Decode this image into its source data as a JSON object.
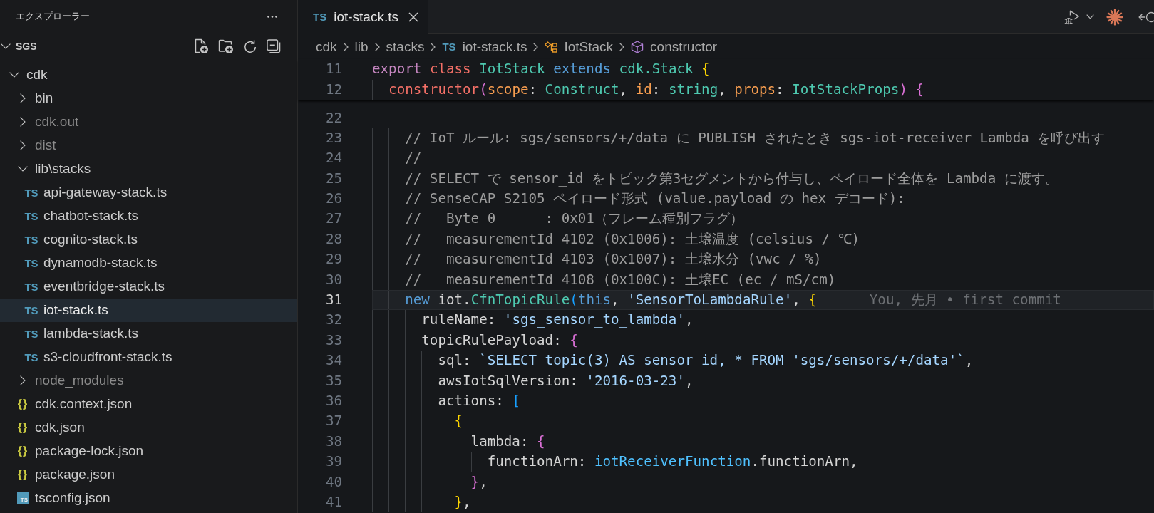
{
  "sidebar": {
    "title": "エクスプローラー",
    "workspace": {
      "name": "SGS",
      "expanded": true
    },
    "tree": [
      {
        "name": "cdk",
        "kind": "folder",
        "expanded": true,
        "selected": false,
        "dimmed": false,
        "children": [
          {
            "name": "bin",
            "kind": "folder",
            "expanded": false,
            "selected": false,
            "dimmed": false
          },
          {
            "name": "cdk.out",
            "kind": "folder",
            "expanded": false,
            "selected": false,
            "dimmed": true
          },
          {
            "name": "dist",
            "kind": "folder",
            "expanded": false,
            "selected": false,
            "dimmed": true
          },
          {
            "name": "lib\\stacks",
            "kind": "folder",
            "expanded": true,
            "selected": false,
            "dimmed": false,
            "children": [
              {
                "name": "api-gateway-stack.ts",
                "kind": "ts",
                "icon": "TS",
                "selected": false,
                "dimmed": false
              },
              {
                "name": "chatbot-stack.ts",
                "kind": "ts",
                "icon": "TS",
                "selected": false,
                "dimmed": false
              },
              {
                "name": "cognito-stack.ts",
                "kind": "ts",
                "icon": "TS",
                "selected": false,
                "dimmed": false
              },
              {
                "name": "dynamodb-stack.ts",
                "kind": "ts",
                "icon": "TS",
                "selected": false,
                "dimmed": false
              },
              {
                "name": "eventbridge-stack.ts",
                "kind": "ts",
                "icon": "TS",
                "selected": false,
                "dimmed": false
              },
              {
                "name": "iot-stack.ts",
                "kind": "ts",
                "icon": "TS",
                "selected": true,
                "dimmed": false
              },
              {
                "name": "lambda-stack.ts",
                "kind": "ts",
                "icon": "TS",
                "selected": false,
                "dimmed": false
              },
              {
                "name": "s3-cloudfront-stack.ts",
                "kind": "ts",
                "icon": "TS",
                "selected": false,
                "dimmed": false
              }
            ]
          },
          {
            "name": "node_modules",
            "kind": "folder",
            "expanded": false,
            "selected": false,
            "dimmed": true
          },
          {
            "name": "cdk.context.json",
            "kind": "json",
            "icon": "{}",
            "selected": false,
            "dimmed": false
          },
          {
            "name": "cdk.json",
            "kind": "json",
            "icon": "{}",
            "selected": false,
            "dimmed": false
          },
          {
            "name": "package-lock.json",
            "kind": "json",
            "icon": "{}",
            "selected": false,
            "dimmed": false
          },
          {
            "name": "package.json",
            "kind": "json",
            "icon": "{}",
            "selected": false,
            "dimmed": false
          },
          {
            "name": "tsconfig.json",
            "kind": "tsconfig",
            "icon": "TS",
            "selected": false,
            "dimmed": false
          }
        ]
      }
    ]
  },
  "editor": {
    "tabs": [
      {
        "label": "iot-stack.ts",
        "icon": "TS",
        "selected": true
      }
    ],
    "breadcrumbs": [
      {
        "label": "cdk",
        "kind": "folder"
      },
      {
        "label": "lib",
        "kind": "folder"
      },
      {
        "label": "stacks",
        "kind": "folder"
      },
      {
        "label": "iot-stack.ts",
        "kind": "file",
        "icon": "TS"
      },
      {
        "label": "IotStack",
        "kind": "class"
      },
      {
        "label": "constructor",
        "kind": "method"
      }
    ],
    "sticky_lines": [
      {
        "number": "11",
        "tokens": [
          {
            "text": "export ",
            "kind": "keyword"
          },
          {
            "text": "class ",
            "kind": "declaration"
          },
          {
            "text": "IotStack ",
            "kind": "type"
          },
          {
            "text": "extends ",
            "kind": "builtin"
          },
          {
            "text": "cdk.Stack ",
            "kind": "type"
          },
          {
            "text": "{",
            "kind": "bracket-1"
          }
        ]
      },
      {
        "number": "12",
        "tokens": [
          {
            "text": "  constructor",
            "kind": "declaration"
          },
          {
            "text": "(",
            "kind": "bracket-2"
          },
          {
            "text": "scope",
            "kind": "parameter"
          },
          {
            "text": ": ",
            "kind": "plain"
          },
          {
            "text": "Construct",
            "kind": "type"
          },
          {
            "text": ", ",
            "kind": "plain"
          },
          {
            "text": "id",
            "kind": "parameter"
          },
          {
            "text": ": ",
            "kind": "plain"
          },
          {
            "text": "string",
            "kind": "type"
          },
          {
            "text": ", ",
            "kind": "plain"
          },
          {
            "text": "props",
            "kind": "parameter"
          },
          {
            "text": ": ",
            "kind": "plain"
          },
          {
            "text": "IotStackProps",
            "kind": "type"
          },
          {
            "text": ") {",
            "kind": "bracket-2"
          }
        ]
      }
    ],
    "lines": [
      {
        "number": "22",
        "current": false
      },
      {
        "number": "23",
        "current": false,
        "tokens": [
          {
            "text": "    // IoT ルール: sgs/sensors/+/data に PUBLISH されたとき sgs-iot-receiver Lambda を呼び出す",
            "kind": "comment"
          }
        ]
      },
      {
        "number": "24",
        "current": false,
        "tokens": [
          {
            "text": "    //",
            "kind": "comment"
          }
        ]
      },
      {
        "number": "25",
        "current": false,
        "tokens": [
          {
            "text": "    // SELECT で sensor_id をトピック第3セグメントから付与し、ペイロード全体を Lambda に渡す。",
            "kind": "comment"
          }
        ]
      },
      {
        "number": "26",
        "current": false,
        "tokens": [
          {
            "text": "    // SenseCAP S2105 ペイロード形式 (value.payload の hex デコード):",
            "kind": "comment"
          }
        ]
      },
      {
        "number": "27",
        "current": false,
        "tokens": [
          {
            "text": "    //   Byte 0      : 0x01（フレーム種別フラグ）",
            "kind": "comment"
          }
        ]
      },
      {
        "number": "28",
        "current": false,
        "tokens": [
          {
            "text": "    //   measurementId 4102 (0x1006): 土壌温度 (celsius / ℃)",
            "kind": "comment"
          }
        ]
      },
      {
        "number": "29",
        "current": false,
        "tokens": [
          {
            "text": "    //   measurementId 4103 (0x1007): 土壌水分 (vwc / %)",
            "kind": "comment"
          }
        ]
      },
      {
        "number": "30",
        "current": false,
        "tokens": [
          {
            "text": "    //   measurementId 4108 (0x100C): 土壌EC (ec / mS/cm)",
            "kind": "comment"
          }
        ]
      },
      {
        "number": "31",
        "current": true,
        "blame": "You, 先月 • first commit",
        "tokens": [
          {
            "text": "    new ",
            "kind": "builtin"
          },
          {
            "text": "iot.",
            "kind": "plain"
          },
          {
            "text": "CfnTopicRule",
            "kind": "type"
          },
          {
            "text": "(",
            "kind": "bracket-3"
          },
          {
            "text": "this",
            "kind": "builtin"
          },
          {
            "text": ", ",
            "kind": "plain"
          },
          {
            "text": "'SensorToLambdaRule'",
            "kind": "string"
          },
          {
            "text": ", ",
            "kind": "plain"
          },
          {
            "text": "{",
            "kind": "bracket-1"
          }
        ]
      },
      {
        "number": "32",
        "current": false,
        "tokens": [
          {
            "text": "      ruleName: ",
            "kind": "plain"
          },
          {
            "text": "'sgs_sensor_to_lambda'",
            "kind": "string"
          },
          {
            "text": ",",
            "kind": "plain"
          }
        ]
      },
      {
        "number": "33",
        "current": false,
        "tokens": [
          {
            "text": "      topicRulePayload: ",
            "kind": "plain"
          },
          {
            "text": "{",
            "kind": "bracket-2"
          }
        ]
      },
      {
        "number": "34",
        "current": false,
        "tokens": [
          {
            "text": "        sql: ",
            "kind": "plain"
          },
          {
            "text": "`SELECT topic(3) AS sensor_id, * FROM 'sgs/sensors/+/data'`",
            "kind": "string"
          },
          {
            "text": ",",
            "kind": "plain"
          }
        ]
      },
      {
        "number": "35",
        "current": false,
        "tokens": [
          {
            "text": "        awsIotSqlVersion: ",
            "kind": "plain"
          },
          {
            "text": "'2016-03-23'",
            "kind": "string"
          },
          {
            "text": ",",
            "kind": "plain"
          }
        ]
      },
      {
        "number": "36",
        "current": false,
        "tokens": [
          {
            "text": "        actions: ",
            "kind": "plain"
          },
          {
            "text": "[",
            "kind": "bracket-3"
          }
        ]
      },
      {
        "number": "37",
        "current": false,
        "tokens": [
          {
            "text": "          {",
            "kind": "bracket-1"
          }
        ]
      },
      {
        "number": "38",
        "current": false,
        "tokens": [
          {
            "text": "            lambda: ",
            "kind": "plain"
          },
          {
            "text": "{",
            "kind": "bracket-2"
          }
        ]
      },
      {
        "number": "39",
        "current": false,
        "tokens": [
          {
            "text": "              functionArn: ",
            "kind": "plain"
          },
          {
            "text": "iotReceiverFunction",
            "kind": "variable"
          },
          {
            "text": ".functionArn,",
            "kind": "plain"
          }
        ]
      },
      {
        "number": "40",
        "current": false,
        "tokens": [
          {
            "text": "            }",
            "kind": "bracket-2"
          },
          {
            "text": ",",
            "kind": "plain"
          }
        ]
      },
      {
        "number": "41",
        "current": false,
        "tokens": [
          {
            "text": "          }",
            "kind": "bracket-1"
          },
          {
            "text": ",",
            "kind": "plain"
          }
        ]
      }
    ]
  }
}
